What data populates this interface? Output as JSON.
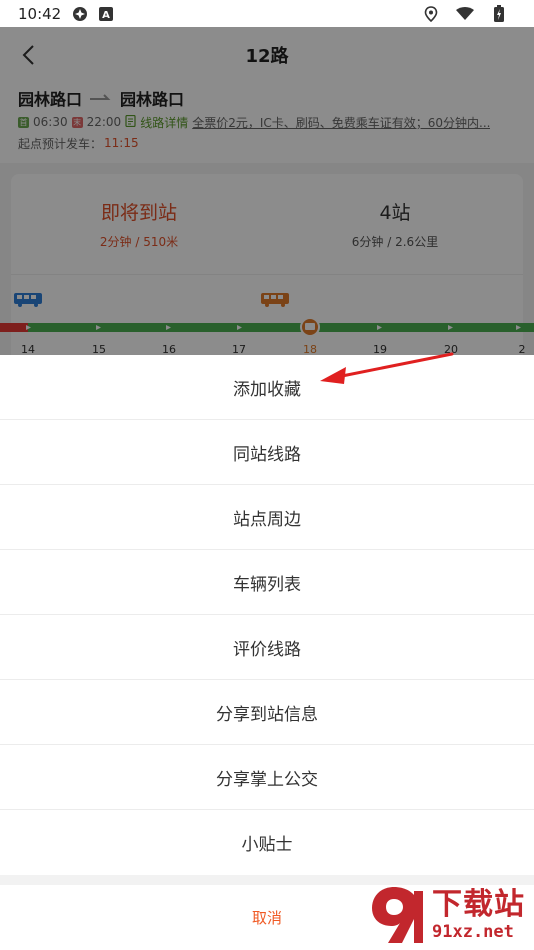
{
  "status_bar": {
    "time": "10:42",
    "icons": [
      "vpn-icon",
      "a-badge-icon",
      "location-icon",
      "wifi-icon",
      "battery-icon"
    ]
  },
  "header": {
    "title": "12路",
    "back_icon": "chevron-left-icon"
  },
  "route": {
    "from": "园林路口",
    "to": "园林路口",
    "first_bus_tag": "首",
    "first_bus": "06:30",
    "last_bus_tag": "末",
    "last_bus": "22:00",
    "detail_link": "线路详情",
    "notice": "全票价2元，IC卡、刷码、免费乘车证有效；60分钟内...",
    "depart_label": "起点预计发车：",
    "depart_time": "11:15"
  },
  "arrival": {
    "next_status": "即将到站",
    "next_detail": "2分钟 / 510米",
    "second_stops": "4站",
    "second_detail": "6分钟 / 2.6公里"
  },
  "stops": [
    "14",
    "15",
    "16",
    "17",
    "18",
    "19",
    "20",
    "2"
  ],
  "current_stop": "18",
  "colors": {
    "accent": "#f05a24",
    "track_green": "#4caf50",
    "bus_blue": "#2f7fd8",
    "bus_orange": "#e07a2a"
  },
  "action_sheet": {
    "items": [
      "添加收藏",
      "同站线路",
      "站点周边",
      "车辆列表",
      "评价线路",
      "分享到站信息",
      "分享掌上公交",
      "小贴士"
    ],
    "cancel": "取消"
  },
  "watermark": {
    "logo_text": "91",
    "brand": "下载站",
    "domain": "91xz.net"
  }
}
